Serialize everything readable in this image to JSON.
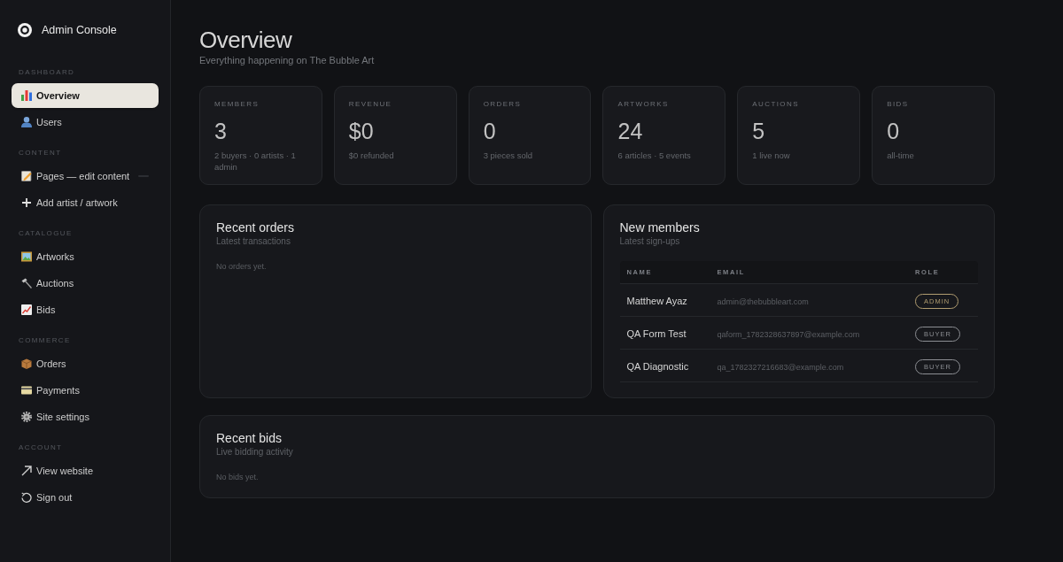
{
  "sidebar": {
    "brand": "Admin Console",
    "sections": [
      {
        "label": "DASHBOARD",
        "items": [
          {
            "label": "Overview",
            "selected": true
          },
          {
            "label": "Users",
            "selected": false
          }
        ]
      },
      {
        "label": "CONTENT",
        "items": [
          {
            "label": "Pages — edit content",
            "selected": false
          },
          {
            "label": "Add artist / artwork",
            "selected": false
          }
        ]
      },
      {
        "label": "CATALOGUE",
        "items": [
          {
            "label": "Artworks",
            "selected": false
          },
          {
            "label": "Auctions",
            "selected": false
          },
          {
            "label": "Bids",
            "selected": false
          }
        ]
      },
      {
        "label": "COMMERCE",
        "items": [
          {
            "label": "Orders",
            "selected": false
          },
          {
            "label": "Payments",
            "selected": false
          },
          {
            "label": "Site settings",
            "selected": false
          }
        ]
      },
      {
        "label": "ACCOUNT",
        "items": [
          {
            "label": "View website",
            "selected": false
          },
          {
            "label": "Sign out",
            "selected": false
          }
        ]
      }
    ]
  },
  "header": {
    "title": "Overview",
    "subtitle": "Everything happening on The Bubble Art"
  },
  "stats": [
    {
      "label": "MEMBERS",
      "value": "3",
      "detail": "2 buyers · 0 artists · 1 admin"
    },
    {
      "label": "REVENUE",
      "value": "$0",
      "detail": "$0 refunded"
    },
    {
      "label": "ORDERS",
      "value": "0",
      "detail": "3 pieces sold"
    },
    {
      "label": "ARTWORKS",
      "value": "24",
      "detail": "6 articles · 5 events"
    },
    {
      "label": "AUCTIONS",
      "value": "5",
      "detail": "1 live now"
    },
    {
      "label": "BIDS",
      "value": "0",
      "detail": "all-time"
    }
  ],
  "recent_orders": {
    "title": "Recent orders",
    "subtitle": "Latest transactions",
    "empty_text": "No orders yet."
  },
  "new_members": {
    "title": "New members",
    "subtitle": "Latest sign-ups",
    "table": {
      "columns": [
        "NAME",
        "EMAIL",
        "ROLE"
      ],
      "rows": [
        {
          "name": "Matthew Ayaz",
          "email": "admin@thebubbleart.com",
          "role": "ADMIN",
          "color": "#b09c70"
        },
        {
          "name": "QA Form Test",
          "email": "qaform_1782328637897@example.com",
          "role": "BUYER",
          "color": "#8c8e93"
        },
        {
          "name": "QA Diagnostic",
          "email": "qa_1782327216683@example.com",
          "role": "BUYER",
          "color": "#8c8e93"
        }
      ]
    }
  },
  "recent_bids": {
    "title": "Recent bids",
    "subtitle": "Live bidding activity",
    "empty_text": "No bids yet."
  }
}
